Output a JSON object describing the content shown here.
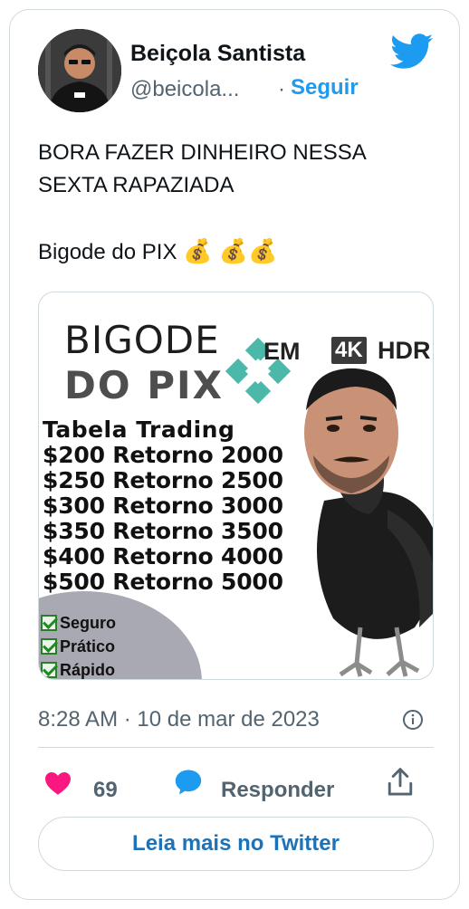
{
  "author": {
    "name": "Beiçola Santista",
    "handle": "@beicola...",
    "separator": "·",
    "follow_label": "Seguir"
  },
  "tweet": {
    "lines": [
      "BORA FAZER DINHEIRO NESSA",
      "SEXTA RAPAZIADA"
    ],
    "second_paragraph": "Bigode do PIX",
    "emoji": "💰 💰💰"
  },
  "media": {
    "title_line1": "BIGODE",
    "title_line2": "DO PIX",
    "badge_em": "EM",
    "badge_4k": "4K",
    "badge_hdr": "HDR",
    "table_title": "Tabela Trading",
    "rows": [
      "$200 Retorno 2000",
      "$250 Retorno 2500",
      "$300 Retorno 3000",
      "$350 Retorno 3500",
      "$400 Retorno 4000",
      "$500 Retorno 5000"
    ],
    "checks": [
      "Seguro",
      "Prático",
      "Rápido"
    ]
  },
  "meta": {
    "timestamp": "8:28 AM · 10 de mar de 2023"
  },
  "actions": {
    "likes": "69",
    "reply_label": "Responder"
  },
  "footer": {
    "read_more": "Leia mais no Twitter"
  },
  "colors": {
    "accent": "#1d9bf0",
    "like": "#f91880",
    "muted": "#536471",
    "border": "#cfd9de"
  },
  "icons": [
    "twitter-bird-icon",
    "info-icon",
    "heart-icon",
    "reply-icon",
    "share-icon",
    "pix-logo-icon"
  ]
}
